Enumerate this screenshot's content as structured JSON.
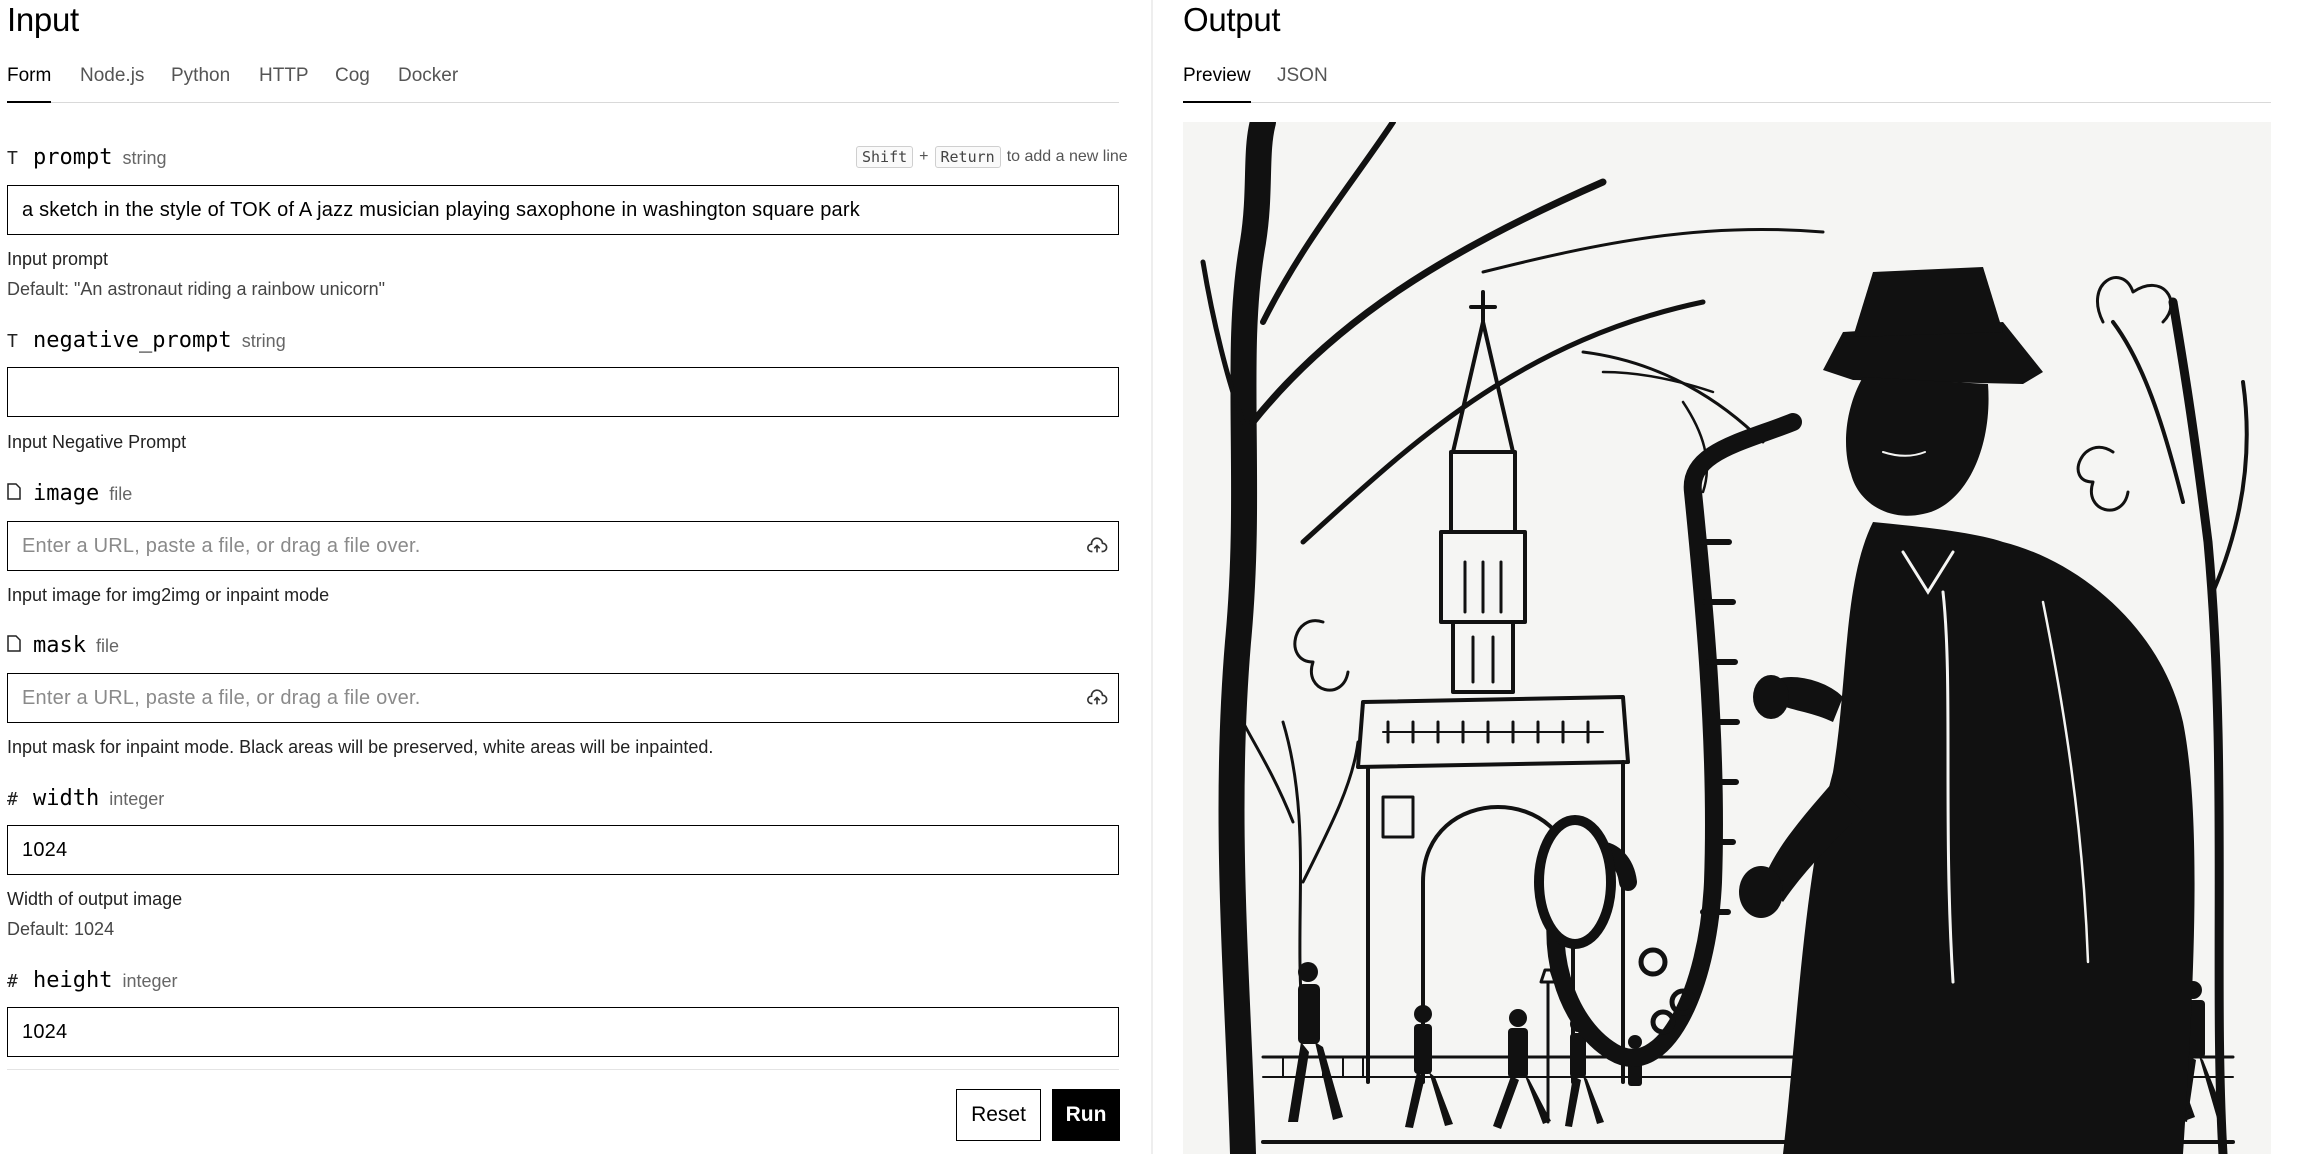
{
  "input_panel": {
    "title": "Input",
    "tabs": [
      "Form",
      "Node.js",
      "Python",
      "HTTP",
      "Cog",
      "Docker"
    ],
    "active_tab": "Form",
    "newline_hint": {
      "key1": "Shift",
      "plus": "+",
      "key2": "Return",
      "text": "to add a new line"
    },
    "fields": {
      "prompt": {
        "icon": "text-type-icon",
        "name": "prompt",
        "type": "string",
        "value": "a sketch in the style of TOK of A jazz musician playing saxophone in washington square park",
        "help": "Input prompt",
        "default": "Default: \"An astronaut riding a rainbow unicorn\""
      },
      "negative_prompt": {
        "icon": "text-type-icon",
        "name": "negative_prompt",
        "type": "string",
        "value": "",
        "help": "Input Negative Prompt"
      },
      "image": {
        "icon": "file-icon",
        "name": "image",
        "type": "file",
        "placeholder": "Enter a URL, paste a file, or drag a file over.",
        "help": "Input image for img2img or inpaint mode"
      },
      "mask": {
        "icon": "file-icon",
        "name": "mask",
        "type": "file",
        "placeholder": "Enter a URL, paste a file, or drag a file over.",
        "help": "Input mask for inpaint mode. Black areas will be preserved, white areas will be inpainted."
      },
      "width": {
        "icon": "hash-icon",
        "name": "width",
        "type": "integer",
        "value": "1024",
        "help": "Width of output image",
        "default": "Default: 1024"
      },
      "height": {
        "icon": "hash-icon",
        "name": "height",
        "type": "integer",
        "value": "1024"
      }
    },
    "buttons": {
      "reset": "Reset",
      "run": "Run"
    }
  },
  "output_panel": {
    "title": "Output",
    "tabs": [
      "Preview",
      "JSON"
    ],
    "active_tab": "Preview",
    "image_subject": "ink sketch of jazz saxophonist in washington square park"
  }
}
